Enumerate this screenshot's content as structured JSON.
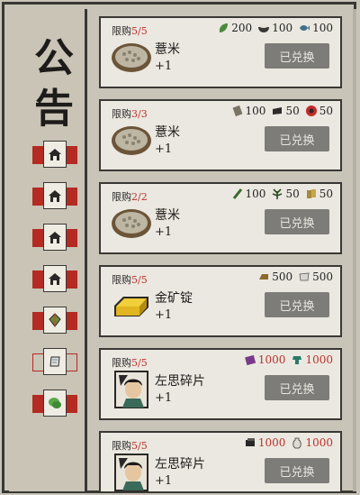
{
  "sidebar": {
    "title_1": "公",
    "title_2": "告",
    "buttons": [
      {
        "icon": "house-icon"
      },
      {
        "icon": "house-icon"
      },
      {
        "icon": "house-icon"
      },
      {
        "icon": "house-icon"
      },
      {
        "icon": "gem-icon"
      },
      {
        "icon": "scroll-icon"
      },
      {
        "icon": "chat-icon"
      }
    ]
  },
  "cards": [
    {
      "limit_label": "限购",
      "limit_count": "5/5",
      "costs": [
        {
          "icon": "leaf-icon",
          "value": "200"
        },
        {
          "icon": "bowl-icon",
          "value": "100"
        },
        {
          "icon": "fish-icon",
          "value": "100"
        }
      ],
      "item_icon": "grain-basket-icon",
      "item_name": "薏米",
      "item_qty": "+1",
      "button": "已兑换"
    },
    {
      "limit_label": "限购",
      "limit_count": "3/3",
      "costs": [
        {
          "icon": "bundle-icon",
          "value": "100"
        },
        {
          "icon": "cloth-icon",
          "value": "50"
        },
        {
          "icon": "red-gem-icon",
          "value": "50"
        }
      ],
      "item_icon": "grain-basket-icon",
      "item_name": "薏米",
      "item_qty": "+1",
      "button": "已兑换"
    },
    {
      "limit_label": "限购",
      "limit_count": "2/2",
      "costs": [
        {
          "icon": "bamboo-icon",
          "value": "100"
        },
        {
          "icon": "herb-icon",
          "value": "50"
        },
        {
          "icon": "wood-icon",
          "value": "50"
        }
      ],
      "item_icon": "grain-basket-icon",
      "item_name": "薏米",
      "item_qty": "+1",
      "button": "已兑换"
    },
    {
      "limit_label": "限购",
      "limit_count": "5/5",
      "costs": [
        {
          "icon": "ingot-small-icon",
          "value": "500"
        },
        {
          "icon": "silk-icon",
          "value": "500"
        }
      ],
      "item_icon": "gold-ingot-icon",
      "item_name": "金矿锭",
      "item_qty": "+1",
      "button": "已兑换"
    },
    {
      "limit_label": "限购",
      "limit_count": "5/5",
      "costs": [
        {
          "icon": "purple-book-icon",
          "value": "1000",
          "red": true
        },
        {
          "icon": "teal-robe-icon",
          "value": "1000",
          "red": true
        }
      ],
      "item_icon": "portrait-icon",
      "item_name": "左思碎片",
      "item_qty": "+1",
      "button": "已兑换"
    },
    {
      "limit_label": "限购",
      "limit_count": "5/5",
      "costs": [
        {
          "icon": "ink-block-icon",
          "value": "1000",
          "red": true
        },
        {
          "icon": "vase-icon",
          "value": "1000",
          "red": true
        }
      ],
      "item_icon": "portrait-icon",
      "item_name": "左思碎片",
      "item_qty": "+1",
      "button": "已兑换"
    }
  ]
}
